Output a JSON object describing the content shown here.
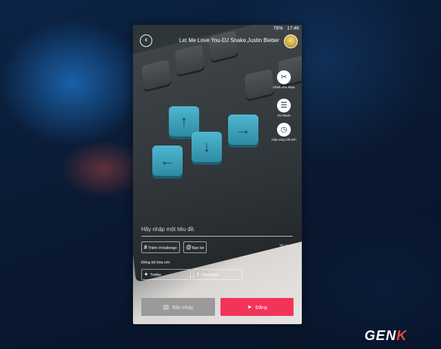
{
  "status_bar": {
    "battery": "76%",
    "time": "17:46"
  },
  "header": {
    "back_icon": "chevron-left-icon",
    "song_title": "Let Me Love You-DJ Snake,Justin Bieber"
  },
  "tools": [
    {
      "icon": "scissors-icon",
      "label": "Chỉnh sửa Nhạc"
    },
    {
      "icon": "sliders-icon",
      "label": "Âm thanh"
    },
    {
      "icon": "clock-icon",
      "label": "Hiệu ứng Cắt ảnh"
    }
  ],
  "caption": {
    "placeholder": "Hãy nhập một tiêu đề."
  },
  "chips": {
    "challenge": "Thêm #challenge",
    "friends": "Bạn bè"
  },
  "char_count": "55 ký tự",
  "sync": {
    "label": "Đồng bộ hóa với:",
    "twitter": "Twitter",
    "facebook": "Facebook"
  },
  "actions": {
    "draft": "Bản nháp",
    "post": "Đăng"
  },
  "watermark": {
    "part1": "GEN",
    "part2": "K"
  },
  "colors": {
    "post_button": "#f2335a",
    "draft_button": "#9a9a9a",
    "keycap": "#3fa6c2"
  }
}
